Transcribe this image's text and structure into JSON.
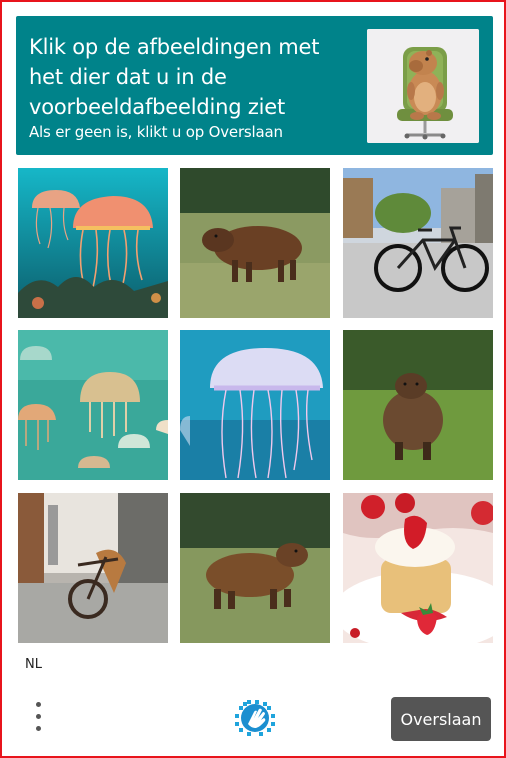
{
  "header": {
    "prompt": "Klik op de afbeeldingen met het dier dat u in de voorbeeldafbeelding ziet",
    "subtext": "Als er geen is, klikt u op Overslaan",
    "sample_image": "capybara-on-office-chair"
  },
  "tiles": [
    {
      "subject": "jellyfish"
    },
    {
      "subject": "capybara"
    },
    {
      "subject": "bicycle"
    },
    {
      "subject": "jellyfish"
    },
    {
      "subject": "jellyfish"
    },
    {
      "subject": "capybara"
    },
    {
      "subject": "bicycle"
    },
    {
      "subject": "capybara"
    },
    {
      "subject": "strawberry-cake"
    }
  ],
  "footer": {
    "language": "NL",
    "skip_label": "Overslaan",
    "menu_icon": "kebab-menu-icon",
    "logo_icon": "hand-logo-icon"
  },
  "colors": {
    "header_bg": "#00838a",
    "frame_border": "#e8141c",
    "skip_bg": "#555555"
  }
}
